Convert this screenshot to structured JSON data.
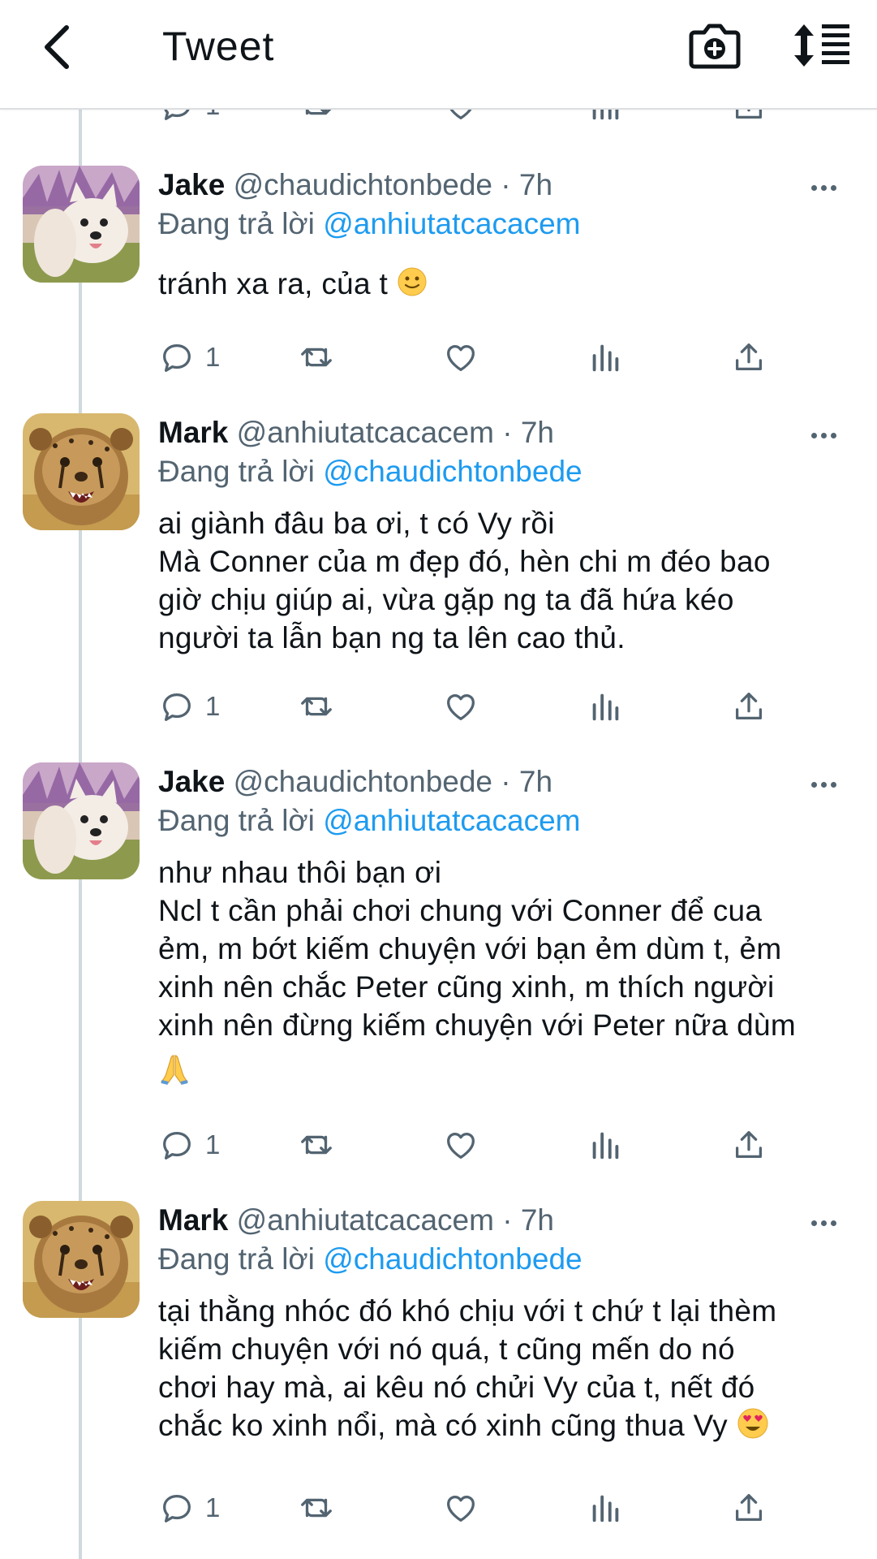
{
  "header": {
    "title": "Tweet"
  },
  "colors": {
    "link": "#1d9bf0",
    "secondary": "#536471",
    "thread_line": "#cfd9de"
  },
  "partial_actions": {
    "reply_count": "1"
  },
  "tweets": [
    {
      "name": "Jake",
      "handle": "@chaudichtonbede · 7h",
      "reply_prefix": "Đang trả lời ",
      "reply_to": "@anhiutatcacacem",
      "text": "tránh xa ra, của t",
      "emoji": "slightly-smiling-face",
      "reply_count": "1"
    },
    {
      "name": "Mark",
      "handle": "@anhiutatcacacem · 7h",
      "reply_prefix": "Đang trả lời ",
      "reply_to": "@chaudichtonbede",
      "text": "ai giành đâu ba ơi, t có Vy rồi\nMà Conner của m đẹp đó, hèn chi m đéo bao\ngiờ chịu giúp ai, vừa gặp ng ta đã hứa kéo\nngười ta lẫn bạn ng ta lên cao thủ.",
      "reply_count": "1"
    },
    {
      "name": "Jake",
      "handle": "@chaudichtonbede · 7h",
      "reply_prefix": "Đang trả lời ",
      "reply_to": "@anhiutatcacacem",
      "text": "như nhau thôi bạn ơi\nNcl t cần phải chơi chung với Conner để cua\nẻm, m bớt kiếm chuyện với bạn ẻm dùm t, ẻm\nxinh nên chắc Peter cũng xinh, m thích người\nxinh nên đừng kiếm chuyện với Peter nữa dùm",
      "emoji": "folded-hands",
      "reply_count": "1"
    },
    {
      "name": "Mark",
      "handle": "@anhiutatcacacem · 7h",
      "reply_prefix": "Đang trả lời ",
      "reply_to": "@chaudichtonbede",
      "text": "tại thằng nhóc đó khó chịu với t chứ t lại thèm\nkiếm chuyện với nó quá, t cũng mến do nó\nchơi hay mà, ai kêu nó chửi Vy của t, nết đó\nchắc ko xinh nổi, mà có xinh cũng thua Vy",
      "emoji": "heart-eyes-face",
      "reply_count": "1"
    }
  ]
}
